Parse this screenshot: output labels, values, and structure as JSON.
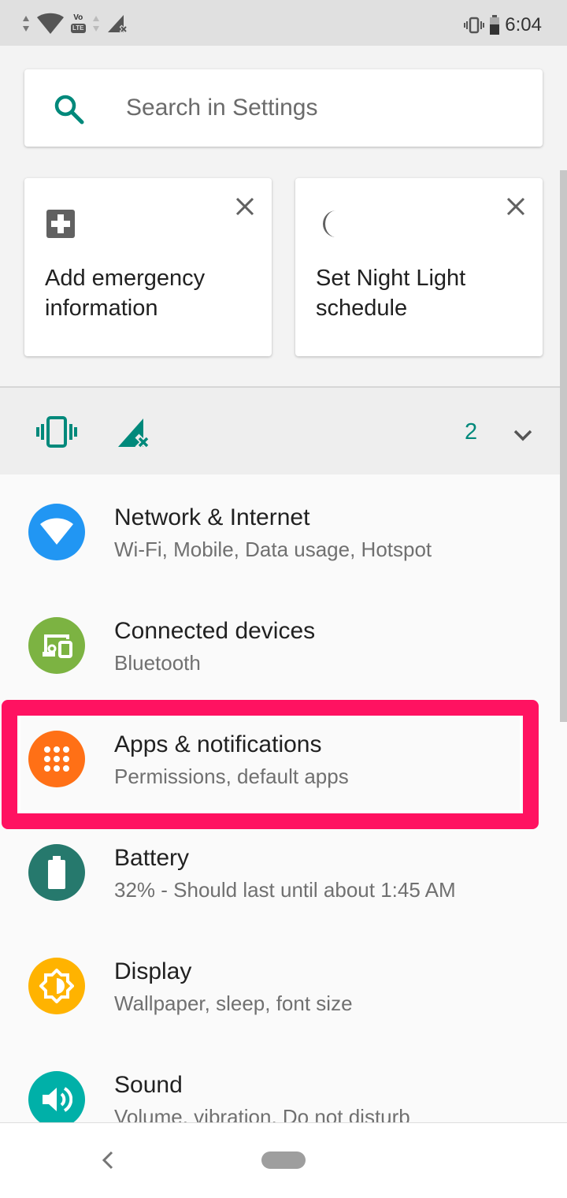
{
  "status_bar": {
    "time": "6:04",
    "volte_label": "Vo",
    "lte_label": "LTE"
  },
  "search": {
    "placeholder": "Search in Settings",
    "icon": "search-icon"
  },
  "suggestions": [
    {
      "title": "Add emergency information",
      "icon": "medical-plus-icon"
    },
    {
      "title": "Set Night Light schedule",
      "icon": "moon-icon"
    }
  ],
  "conditions": {
    "icons": [
      "vibrate-icon",
      "no-signal-icon"
    ],
    "count": "2"
  },
  "settings": [
    {
      "title": "Network & Internet",
      "subtitle": "Wi-Fi, Mobile, Data usage, Hotspot",
      "icon": "wifi-icon",
      "color": "#2196f3"
    },
    {
      "title": "Connected devices",
      "subtitle": "Bluetooth",
      "icon": "devices-icon",
      "color": "#7cb342"
    },
    {
      "title": "Apps & notifications",
      "subtitle": "Permissions, default apps",
      "icon": "apps-grid-icon",
      "color": "#ff7016"
    },
    {
      "title": "Battery",
      "subtitle": "32% - Should last until about 1:45 AM",
      "icon": "battery-icon",
      "color": "#26796d"
    },
    {
      "title": "Display",
      "subtitle": "Wallpaper, sleep, font size",
      "icon": "brightness-icon",
      "color": "#ffb300"
    },
    {
      "title": "Sound",
      "subtitle": "Volume, vibration, Do not disturb",
      "icon": "volume-icon",
      "color": "#00b0a8"
    }
  ],
  "colors": {
    "accent": "#00897b",
    "highlight": "#ff1261"
  }
}
